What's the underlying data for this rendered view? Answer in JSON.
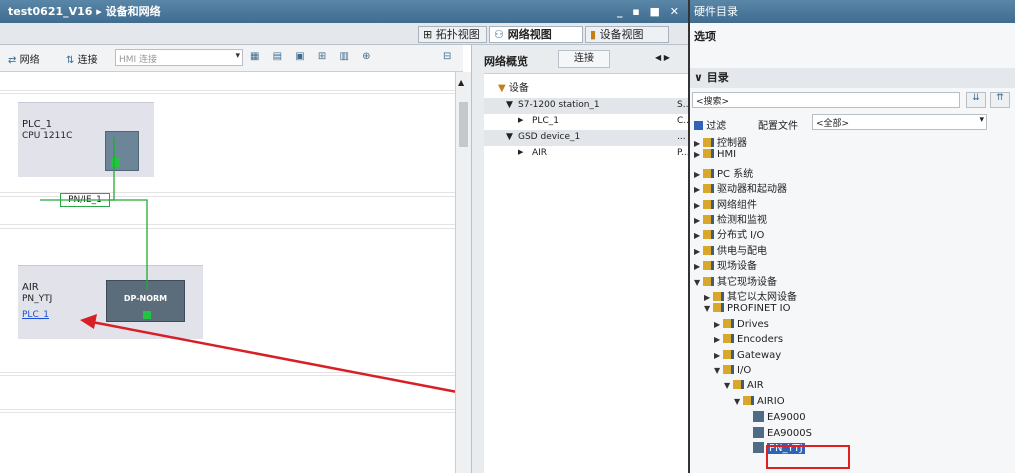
{
  "window": {
    "title": "test0621_V16 ▸ 设备和网络",
    "controls": "_ ▪ ■ ✕"
  },
  "views": {
    "topology": "拓扑视图",
    "network": "网络视图",
    "device": "设备视图"
  },
  "toolbar": {
    "network": "网络",
    "connect": "连接",
    "connect_type": "HMI 连接"
  },
  "overview": {
    "tab_overview": "网络概览",
    "tab_connect": "连接",
    "header": "设备",
    "rows": [
      {
        "arrow": "▼",
        "name": "S7-1200 station_1",
        "type": "S..."
      },
      {
        "arrow": "▶",
        "name": "PLC_1",
        "type": "C..."
      },
      {
        "arrow": "▼",
        "name": "GSD device_1",
        "type": "..."
      },
      {
        "arrow": "▶",
        "name": "AIR",
        "type": "P..."
      }
    ]
  },
  "canvas": {
    "plc": {
      "name": "PLC_1",
      "cpu": "CPU 1211C"
    },
    "network_label": "PN/IE_1",
    "air": {
      "name": "AIR",
      "type": "PN_YTJ",
      "link": "PLC_1",
      "module": "DP-NORM"
    }
  },
  "hw_catalog": {
    "title": "硬件目录",
    "options": "选项",
    "catalog": "目录",
    "search": "<搜索>",
    "filter": "过滤",
    "profile_label": "配置文件",
    "profile_value": "<全部>",
    "items": [
      {
        "label": "控制器",
        "level": 0,
        "arrow": "▶",
        "icon": "folder"
      },
      {
        "label": "HMI",
        "level": 0,
        "arrow": "▶",
        "icon": "folder"
      },
      {
        "label": "PC 系统",
        "level": 0,
        "arrow": "▶",
        "icon": "folder"
      },
      {
        "label": "驱动器和起动器",
        "level": 0,
        "arrow": "▶",
        "icon": "folder"
      },
      {
        "label": "网络组件",
        "level": 0,
        "arrow": "▶",
        "icon": "folder"
      },
      {
        "label": "检测和监视",
        "level": 0,
        "arrow": "▶",
        "icon": "folder"
      },
      {
        "label": "分布式 I/O",
        "level": 0,
        "arrow": "▶",
        "icon": "folder"
      },
      {
        "label": "供电与配电",
        "level": 0,
        "arrow": "▶",
        "icon": "folder"
      },
      {
        "label": "现场设备",
        "level": 0,
        "arrow": "▶",
        "icon": "folder"
      },
      {
        "label": "其它现场设备",
        "level": 0,
        "arrow": "▼",
        "icon": "folder"
      },
      {
        "label": "其它以太网设备",
        "level": 1,
        "arrow": "▶",
        "icon": "folder"
      },
      {
        "label": "PROFINET IO",
        "level": 1,
        "arrow": "▼",
        "icon": "folder"
      },
      {
        "label": "Drives",
        "level": 2,
        "arrow": "▶",
        "icon": "folder"
      },
      {
        "label": "Encoders",
        "level": 2,
        "arrow": "▶",
        "icon": "folder"
      },
      {
        "label": "Gateway",
        "level": 2,
        "arrow": "▶",
        "icon": "folder"
      },
      {
        "label": "I/O",
        "level": 2,
        "arrow": "▼",
        "icon": "folder"
      },
      {
        "label": "AIR",
        "level": 3,
        "arrow": "▼",
        "icon": "folder"
      },
      {
        "label": "AIRIO",
        "level": 4,
        "arrow": "▼",
        "icon": "folder"
      },
      {
        "label": "EA9000",
        "level": 5,
        "arrow": "",
        "icon": "device"
      },
      {
        "label": "EA9000S",
        "level": 5,
        "arrow": "",
        "icon": "device"
      },
      {
        "label": "PN_YTJ",
        "level": 5,
        "arrow": "",
        "icon": "device",
        "selected": true
      }
    ]
  },
  "colors": {
    "title": "#3f6c8f",
    "link": "#22aa33",
    "arrow": "#d81f26",
    "highlight": "#e02020",
    "selected_bg": "#2f63b8"
  }
}
